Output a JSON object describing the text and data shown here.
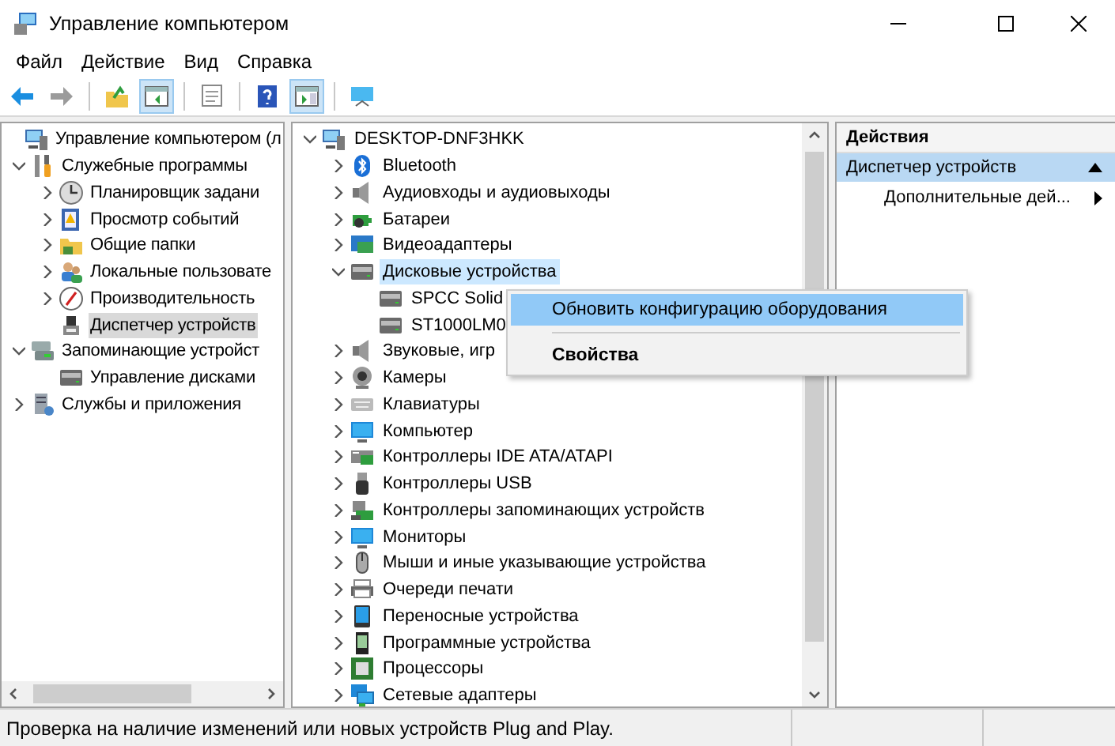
{
  "window": {
    "title": "Управление компьютером"
  },
  "menu": [
    "Файл",
    "Действие",
    "Вид",
    "Справка"
  ],
  "toolbar": [
    {
      "kind": "back",
      "disabled": false,
      "pressed": false
    },
    {
      "kind": "forward",
      "disabled": true,
      "pressed": false
    },
    {
      "kind": "separator"
    },
    {
      "kind": "up",
      "disabled": false,
      "pressed": false
    },
    {
      "kind": "tree",
      "disabled": false,
      "pressed": true
    },
    {
      "kind": "separator"
    },
    {
      "kind": "properties",
      "disabled": false,
      "pressed": false
    },
    {
      "kind": "separator"
    },
    {
      "kind": "help",
      "disabled": false,
      "pressed": false
    },
    {
      "kind": "action_pane",
      "disabled": false,
      "pressed": true
    },
    {
      "kind": "separator"
    },
    {
      "kind": "monitor",
      "disabled": false,
      "pressed": false
    }
  ],
  "nav_tree": [
    {
      "label": "Управление компьютером (л",
      "selected": false,
      "children": [
        {
          "label": "Служебные программы",
          "selected": false,
          "expanded": true,
          "children": [
            {
              "label": "Планировщик задани",
              "selected": false,
              "expanded": false
            },
            {
              "label": "Просмотр событий",
              "selected": false,
              "expanded": false
            },
            {
              "label": "Общие папки",
              "selected": false,
              "expanded": false
            },
            {
              "label": "Локальные пользовате",
              "selected": false,
              "expanded": false
            },
            {
              "label": "Производительность",
              "selected": false,
              "expanded": false
            },
            {
              "label": "Диспетчер устройств",
              "selected": true
            }
          ]
        },
        {
          "label": "Запоминающие устройст",
          "selected": false,
          "expanded": true,
          "children": [
            {
              "label": "Управление дисками",
              "selected": false
            }
          ]
        },
        {
          "label": "Службы и приложения",
          "selected": false,
          "expanded": false
        }
      ]
    }
  ],
  "device_tree": [
    {
      "label": "DESKTOP-DNF3HKK",
      "selected": false,
      "expanded": true,
      "children": [
        {
          "label": "Bluetooth",
          "selected": false,
          "expanded": false
        },
        {
          "label": "Аудиовходы и аудиовыходы",
          "selected": false,
          "expanded": false
        },
        {
          "label": "Батареи",
          "selected": false,
          "expanded": false
        },
        {
          "label": "Видеоадаптеры",
          "selected": false,
          "expanded": false
        },
        {
          "label": "Дисковые устройства",
          "selected": true,
          "expanded": true,
          "children": [
            {
              "label": "SPCC Solid",
              "selected": false
            },
            {
              "label": "ST1000LM0",
              "selected": false
            }
          ]
        },
        {
          "label": "Звуковые, игр",
          "selected": false,
          "expanded": false
        },
        {
          "label": "Камеры",
          "selected": false,
          "expanded": false
        },
        {
          "label": "Клавиатуры",
          "selected": false,
          "expanded": false
        },
        {
          "label": "Компьютер",
          "selected": false,
          "expanded": false
        },
        {
          "label": "Контроллеры IDE ATA/ATAPI",
          "selected": false,
          "expanded": false
        },
        {
          "label": "Контроллеры USB",
          "selected": false,
          "expanded": false
        },
        {
          "label": "Контроллеры запоминающих устройств",
          "selected": false,
          "expanded": false
        },
        {
          "label": "Мониторы",
          "selected": false,
          "expanded": false
        },
        {
          "label": "Мыши и иные указывающие устройства",
          "selected": false,
          "expanded": false
        },
        {
          "label": "Очереди печати",
          "selected": false,
          "expanded": false
        },
        {
          "label": "Переносные устройства",
          "selected": false,
          "expanded": false
        },
        {
          "label": "Программные устройства",
          "selected": false,
          "expanded": false
        },
        {
          "label": "Процессоры",
          "selected": false,
          "expanded": false
        },
        {
          "label": "Сетевые адаптеры",
          "selected": false,
          "expanded": false
        }
      ]
    }
  ],
  "context_menu": {
    "items": [
      {
        "kind": "item",
        "label": "Обновить конфигурацию оборудования",
        "selected": true,
        "default": false
      },
      {
        "kind": "separator"
      },
      {
        "kind": "item",
        "label": "Свойства",
        "selected": false,
        "default": true
      }
    ]
  },
  "actions_pane": {
    "header": "Действия",
    "sections": [
      {
        "title": "Диспетчер устройств",
        "selected": true,
        "expanded": true,
        "items": [
          "Дополнительные дей..."
        ]
      }
    ]
  },
  "status_bar": {
    "text": "Проверка на наличие изменений или новых устройств Plug and Play."
  }
}
